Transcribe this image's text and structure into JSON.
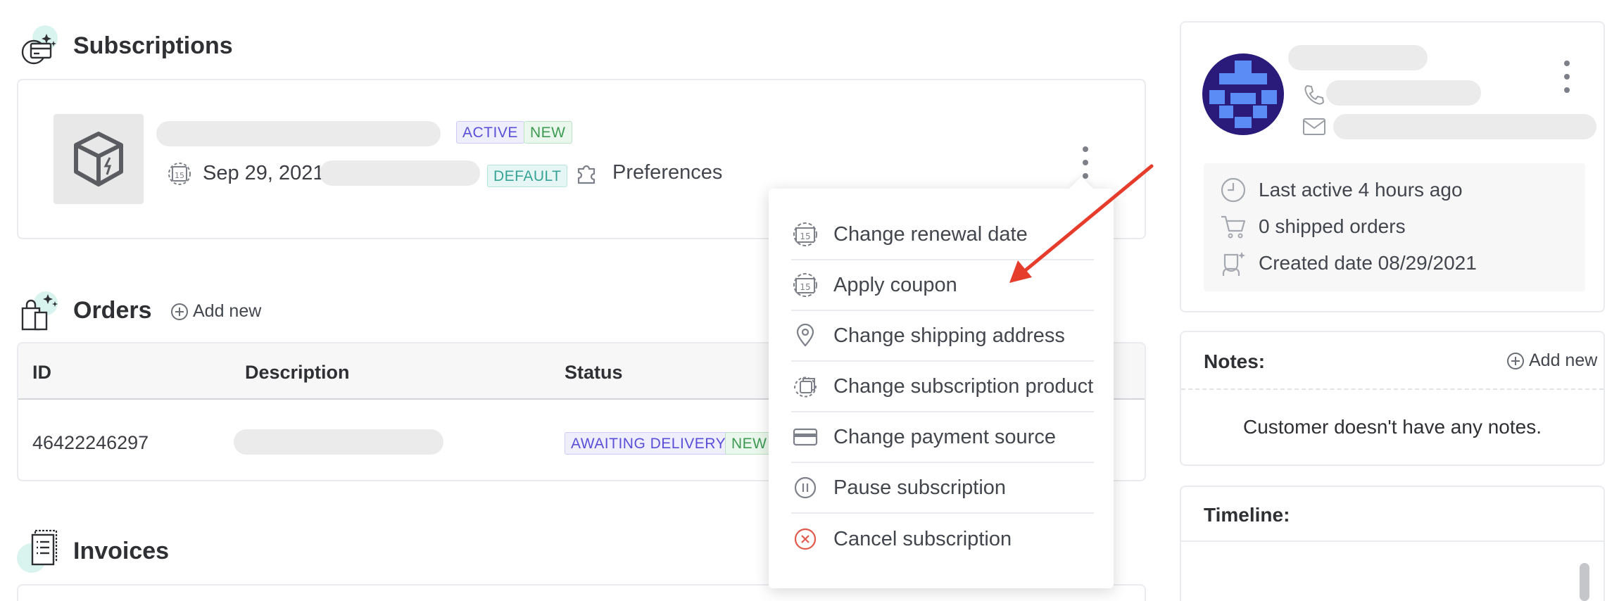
{
  "subscriptions": {
    "title": "Subscriptions",
    "item": {
      "badge_active": "ACTIVE",
      "badge_new": "NEW",
      "date": "Sep 29, 2021",
      "badge_default": "DEFAULT",
      "preferences_label": "Preferences"
    }
  },
  "dropdown": {
    "items": [
      {
        "label": "Change renewal date",
        "icon": "calendar-icon"
      },
      {
        "label": "Apply coupon",
        "icon": "calendar-icon"
      },
      {
        "label": "Change shipping address",
        "icon": "map-pin-icon"
      },
      {
        "label": "Change subscription product",
        "icon": "swap-product-icon"
      },
      {
        "label": "Change payment source",
        "icon": "credit-card-icon"
      },
      {
        "label": "Pause subscription",
        "icon": "pause-icon"
      },
      {
        "label": "Cancel subscription",
        "icon": "cancel-icon"
      }
    ],
    "colors": {
      "cancel": "#e05a4e",
      "arrow": "#e53c2c"
    }
  },
  "orders": {
    "title": "Orders",
    "add_new": "Add new",
    "columns": {
      "id": "ID",
      "description": "Description",
      "status": "Status"
    },
    "rows": [
      {
        "id": "46422246297",
        "status_badge": "AWAITING DELIVERY",
        "new_badge": "NEW"
      }
    ]
  },
  "invoices": {
    "title": "Invoices"
  },
  "customer": {
    "stats": {
      "last_active": "Last active 4 hours ago",
      "shipped_orders": "0 shipped orders",
      "created": "Created date 08/29/2021"
    }
  },
  "notes": {
    "title": "Notes:",
    "add_new": "Add new",
    "empty": "Customer doesn't have any notes."
  },
  "timeline": {
    "title": "Timeline:"
  }
}
